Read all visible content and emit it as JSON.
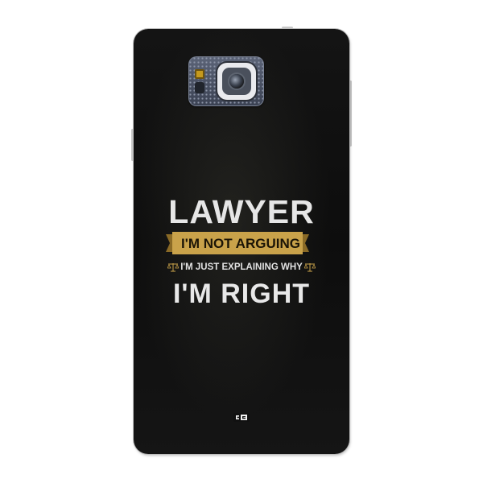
{
  "product": {
    "headline": "LAWYER",
    "banner": "I'M NOT ARGUING",
    "subline": "I'M JUST EXPLAINING WHY",
    "closing": "I'M RIGHT",
    "brand_logo": "CC"
  },
  "colors": {
    "case_background": "#111111",
    "text_light": "#e6e6e6",
    "banner_gold": "#c9a24a",
    "banner_text": "#1b1406"
  },
  "icons": [
    "camera-lens-icon",
    "flash-icon",
    "scale-icon",
    "brand-logo-icon"
  ]
}
